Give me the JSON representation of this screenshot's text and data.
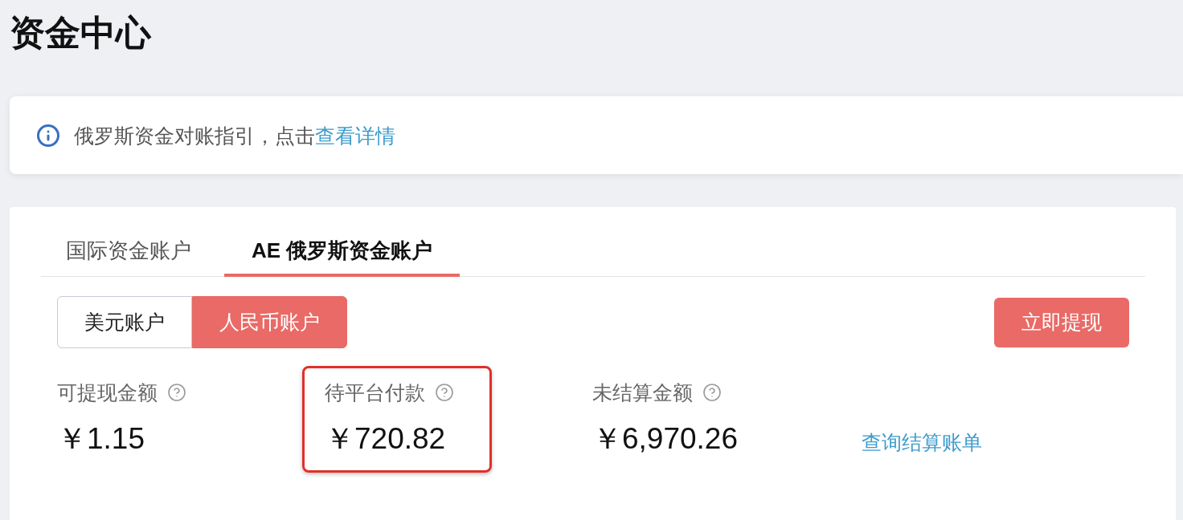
{
  "page": {
    "title": "资金中心"
  },
  "notice": {
    "text": "俄罗斯资金对账指引，点击",
    "link": "查看详情"
  },
  "tabs": [
    {
      "label": "国际资金账户",
      "selected": false
    },
    {
      "label": "AE 俄罗斯资金账户",
      "selected": true
    }
  ],
  "currency_toggle": [
    {
      "label": "美元账户",
      "selected": false
    },
    {
      "label": "人民币账户",
      "selected": true
    }
  ],
  "withdraw_button": {
    "label": "立即提现"
  },
  "stats": [
    {
      "label": "可提现金额",
      "value": "￥1.15",
      "highlighted": false
    },
    {
      "label": "待平台付款",
      "value": "￥720.82",
      "highlighted": true
    },
    {
      "label": "未结算金额",
      "value": "￥6,970.26",
      "highlighted": false
    }
  ],
  "bill_link": {
    "label": "查询结算账单"
  }
}
